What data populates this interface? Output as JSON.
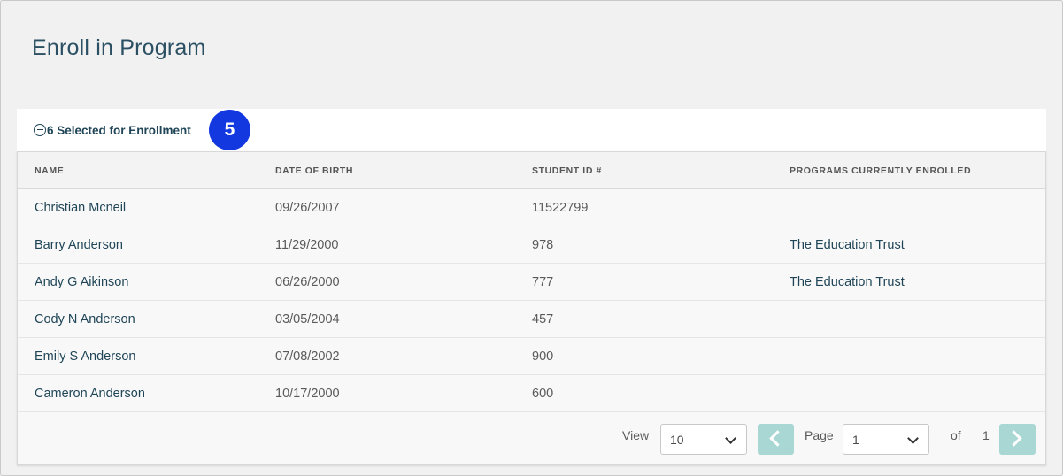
{
  "page": {
    "title": "Enroll in Program"
  },
  "selection": {
    "label": "6 Selected for Enrollment",
    "step_badge": "5",
    "badge_color": "#1438e0"
  },
  "table": {
    "columns": [
      "NAME",
      "DATE OF BIRTH",
      "STUDENT ID #",
      "PROGRAMS CURRENTLY ENROLLED"
    ],
    "rows": [
      {
        "name": "Christian Mcneil",
        "dob": "09/26/2007",
        "student_id": "11522799",
        "programs": ""
      },
      {
        "name": "Barry Anderson",
        "dob": "11/29/2000",
        "student_id": "978",
        "programs": "The Education Trust"
      },
      {
        "name": "Andy G Aikinson",
        "dob": "06/26/2000",
        "student_id": "777",
        "programs": "The Education Trust"
      },
      {
        "name": "Cody N Anderson",
        "dob": "03/05/2004",
        "student_id": "457",
        "programs": ""
      },
      {
        "name": "Emily S Anderson",
        "dob": "07/08/2002",
        "student_id": "900",
        "programs": ""
      },
      {
        "name": "Cameron Anderson",
        "dob": "10/17/2000",
        "student_id": "600",
        "programs": ""
      }
    ]
  },
  "pagination": {
    "view_label": "View",
    "view_value": "10",
    "page_label": "Page",
    "page_value": "1",
    "of_label": "of",
    "total_pages": "1"
  },
  "icons": {
    "collapse": "minus-circle-icon",
    "prev": "chevron-left-icon",
    "next": "chevron-right-icon",
    "dropdown": "chevron-down-icon"
  },
  "colors": {
    "link": "#1f4557",
    "nav_button": "#a9d8d4",
    "title": "#2b4f63"
  }
}
